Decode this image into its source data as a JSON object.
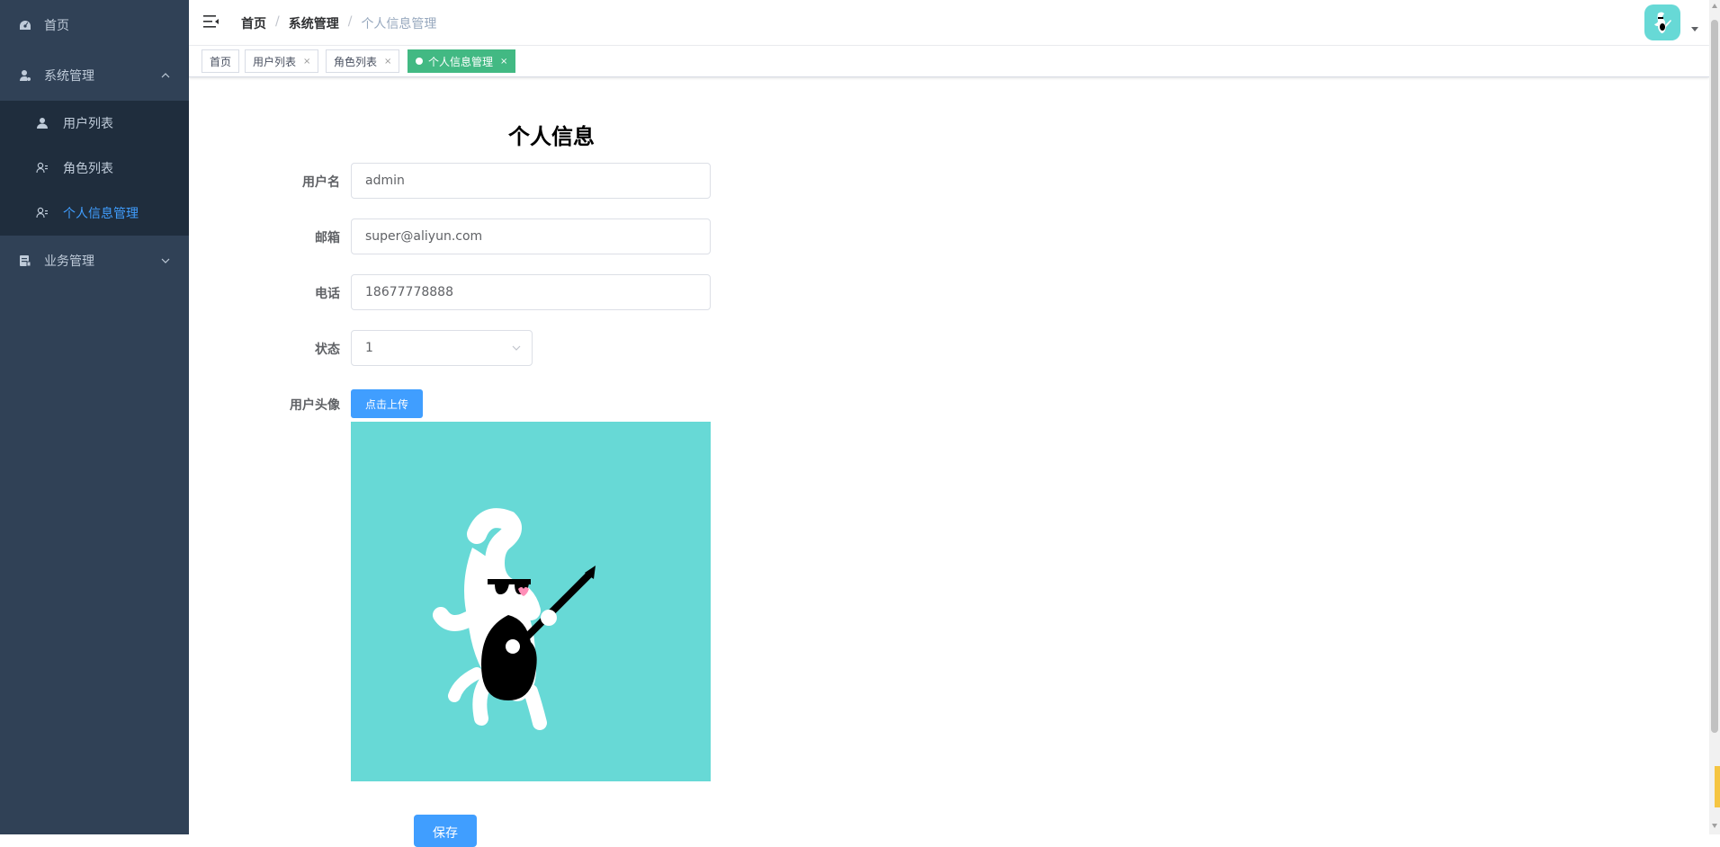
{
  "sidebar": {
    "home": "首页",
    "system": "系统管理",
    "system_items": [
      "用户列表",
      "角色列表",
      "个人信息管理"
    ],
    "business": "业务管理"
  },
  "breadcrumb": [
    "首页",
    "系统管理",
    "个人信息管理"
  ],
  "tags": [
    "首页",
    "用户列表",
    "角色列表",
    "个人信息管理"
  ],
  "tag_close": "×",
  "form": {
    "title": "个人信息",
    "username_label": "用户名",
    "username": "admin",
    "email_label": "邮箱",
    "email": "super@aliyun.com",
    "phone_label": "电话",
    "phone": "18677778888",
    "status_label": "状态",
    "status": "1",
    "avatar_label": "用户头像",
    "upload_label": "点击上传",
    "save_label": "保存"
  },
  "colors": {
    "sidebar_bg": "#304156",
    "submenu_bg": "#1f2d3d",
    "active": "#409eff",
    "tag_active": "#42b983",
    "avatar_bg": "#67d9d6"
  },
  "icons": {
    "home": "dashboard-icon",
    "system": "user-admin-icon",
    "user_list": "user-icon",
    "role_list": "user-list-icon",
    "profile": "user-list-icon",
    "business": "document-icon",
    "hamburger": "hamburger-icon"
  }
}
